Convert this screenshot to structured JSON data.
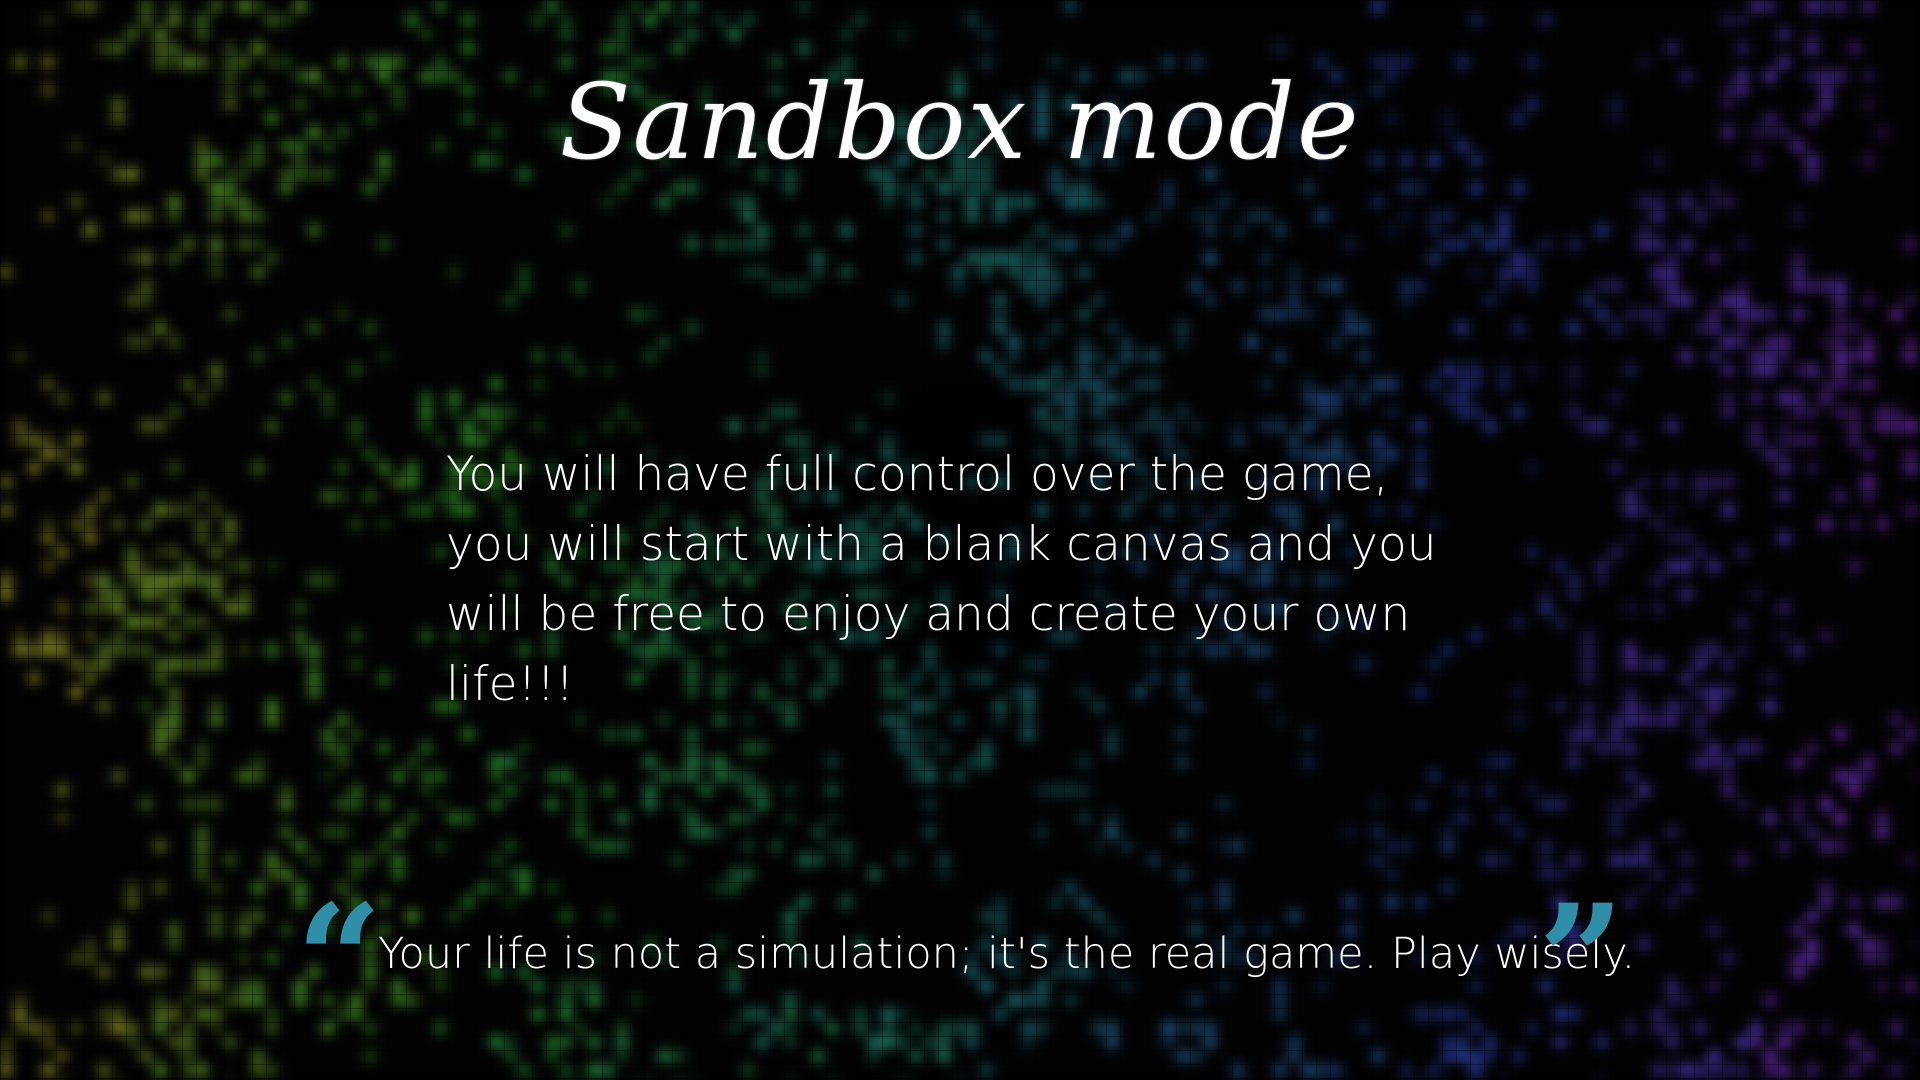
{
  "screen": {
    "title": "Sandbox mode",
    "description": "You will have full control over the game, you will start with a blank canvas and you will be free to enjoy and create your own life!!!",
    "quote": {
      "open_mark": "“",
      "text": "Your life is not a simulation; it's the real game. Play wisely.",
      "close_mark": "”"
    }
  },
  "colors": {
    "background": "#020203",
    "text": "#ffffff",
    "quote_mark": "#2f8fa8",
    "cell_gradient": [
      "#a3a024",
      "#2fb52a",
      "#22a7a0",
      "#2f49c8",
      "#7a2cc6"
    ]
  },
  "background_art": {
    "type": "blurred-cellular-automaton-grid",
    "cells": "scattered glowing squares with rainbow gradient left to right"
  }
}
